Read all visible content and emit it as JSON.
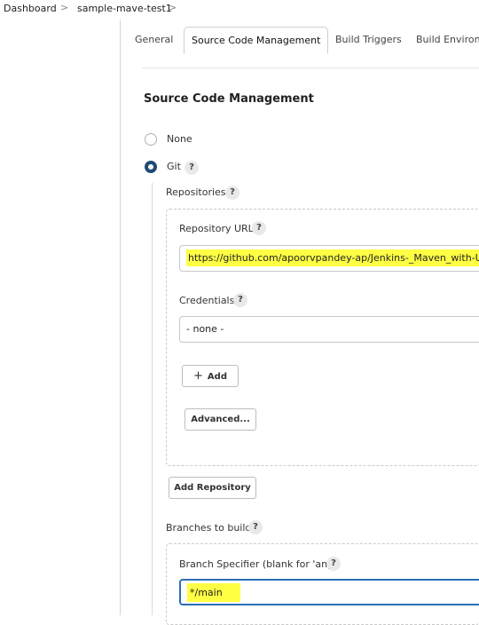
{
  "breadcrumb": {
    "items": [
      "Dashboard",
      "sample-mave-test1"
    ],
    "separator": ">"
  },
  "tabs": [
    "General",
    "Source Code Management",
    "Build Triggers",
    "Build Environm"
  ],
  "section_title": "Source Code Management",
  "scm": {
    "none_label": "None",
    "git_label": "Git",
    "selected": "Git"
  },
  "help_glyph": "?",
  "repositories": {
    "label": "Repositories",
    "url_label": "Repository URL",
    "url_value": "https://github.com/apoorvpandey-ap/Jenkins-_Maven_with-UT",
    "credentials_label": "Credentials",
    "credentials_value": "- none -",
    "add_label": "Add",
    "add_icon": "+",
    "advanced_label": "Advanced...",
    "add_repository_label": "Add Repository"
  },
  "branches": {
    "label": "Branches to build",
    "specifier_label": "Branch Specifier (blank for 'any')",
    "specifier_value": "*/main"
  },
  "colors": {
    "highlight": "#ffff44",
    "radio_checked": "#1f4a75"
  }
}
